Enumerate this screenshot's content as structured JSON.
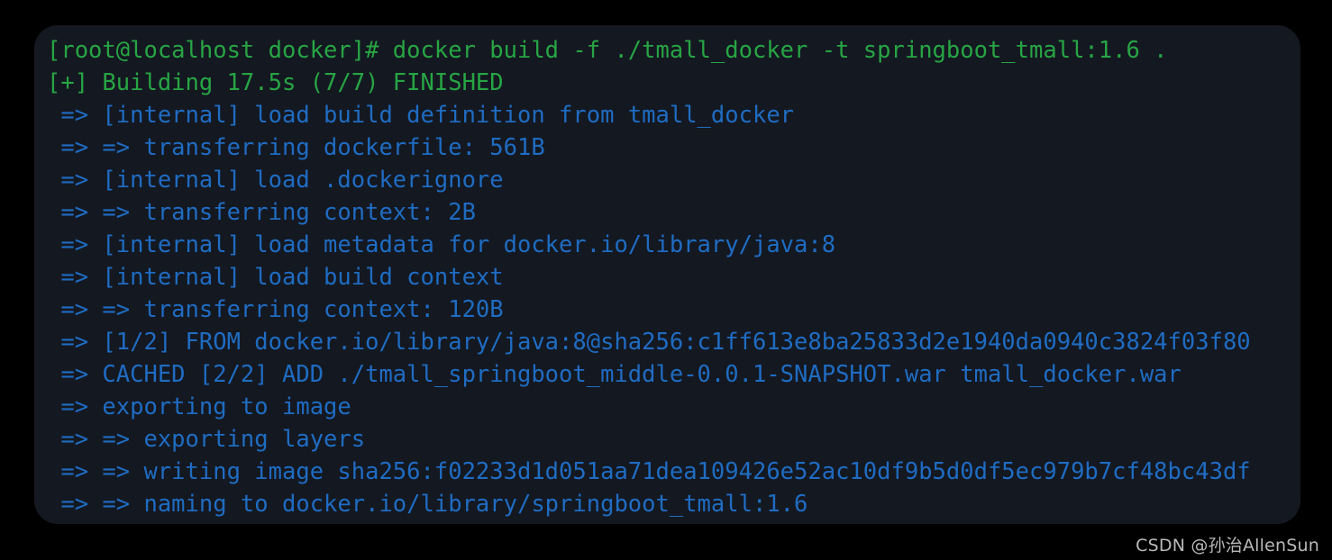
{
  "terminal": {
    "background_color": "#141821",
    "prompt_color": "#27a544",
    "output_color": "#1f6cc2",
    "lines": [
      {
        "text": "[root@localhost docker]# docker build -f ./tmall_docker -t springboot_tmall:1.6 .",
        "color": "green"
      },
      {
        "text": "[+] Building 17.5s (7/7) FINISHED",
        "color": "green"
      },
      {
        "text": " => [internal] load build definition from tmall_docker",
        "color": "blue"
      },
      {
        "text": " => => transferring dockerfile: 561B",
        "color": "blue"
      },
      {
        "text": " => [internal] load .dockerignore",
        "color": "blue"
      },
      {
        "text": " => => transferring context: 2B",
        "color": "blue"
      },
      {
        "text": " => [internal] load metadata for docker.io/library/java:8",
        "color": "blue"
      },
      {
        "text": " => [internal] load build context",
        "color": "blue"
      },
      {
        "text": " => => transferring context: 120B",
        "color": "blue"
      },
      {
        "text": " => [1/2] FROM docker.io/library/java:8@sha256:c1ff613e8ba25833d2e1940da0940c3824f03f80",
        "color": "blue"
      },
      {
        "text": " => CACHED [2/2] ADD ./tmall_springboot_middle-0.0.1-SNAPSHOT.war tmall_docker.war",
        "color": "blue"
      },
      {
        "text": " => exporting to image",
        "color": "blue"
      },
      {
        "text": " => => exporting layers",
        "color": "blue"
      },
      {
        "text": " => => writing image sha256:f02233d1d051aa71dea109426e52ac10df9b5d0df5ec979b7cf48bc43df",
        "color": "blue"
      },
      {
        "text": " => => naming to docker.io/library/springboot_tmall:1.6",
        "color": "blue"
      }
    ],
    "clipped_line": {
      "text": " => => naming to docker.io/library/springboot_tmall",
      "color": "green"
    }
  },
  "watermark": {
    "text": "CSDN @孙治AllenSun"
  }
}
